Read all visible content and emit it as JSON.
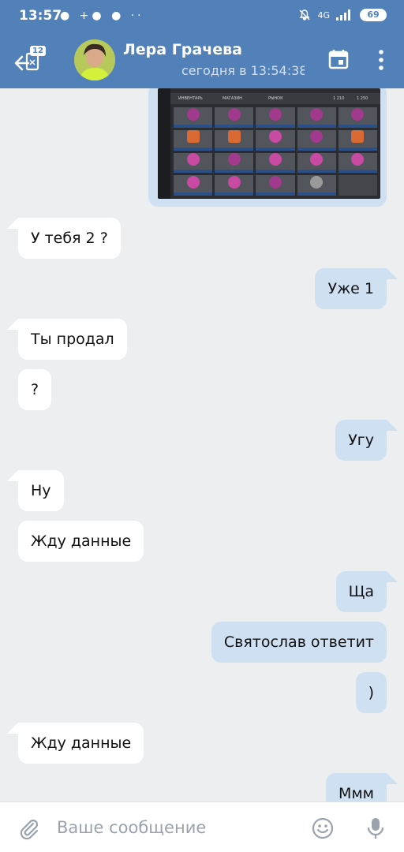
{
  "status_bar": {
    "time": "13:57",
    "left_icons": "● +● ● ⋅⋅",
    "network": "4G",
    "battery": "69"
  },
  "header": {
    "unread_badge": "12",
    "contact_name": "Лера Грачева",
    "contact_status": "сегодня в 13:54:38",
    "icons": [
      "back-arrow-icon",
      "calendar-icon",
      "more-vertical-icon"
    ]
  },
  "photo_message": {
    "tabs": [
      "ИНВЕНТАРЬ",
      "МАГАЗИН",
      "РЫНОК"
    ],
    "badges": [
      "1 210",
      "1 250"
    ]
  },
  "messages": [
    {
      "dir": "in",
      "text": "У тебя 2 ?"
    },
    {
      "dir": "out",
      "text": "Уже 1"
    },
    {
      "dir": "in",
      "text": "Ты продал"
    },
    {
      "dir": "in",
      "text": "?"
    },
    {
      "dir": "out",
      "text": "Угу"
    },
    {
      "dir": "in",
      "text": "Ну"
    },
    {
      "dir": "in",
      "text": "Жду данные"
    },
    {
      "dir": "out",
      "text": "Ща"
    },
    {
      "dir": "out",
      "text": "Святослав ответит"
    },
    {
      "dir": "out",
      "text": ")"
    },
    {
      "dir": "in",
      "text": "Жду данные"
    },
    {
      "dir": "out",
      "text": "Ммм"
    }
  ],
  "input": {
    "placeholder": "Ваше сообщение",
    "value": ""
  },
  "colors": {
    "header_bg": "#5181b8",
    "chat_bg": "#edeef0",
    "incoming_bubble": "#ffffff",
    "outgoing_bubble": "#cfe0f3"
  }
}
